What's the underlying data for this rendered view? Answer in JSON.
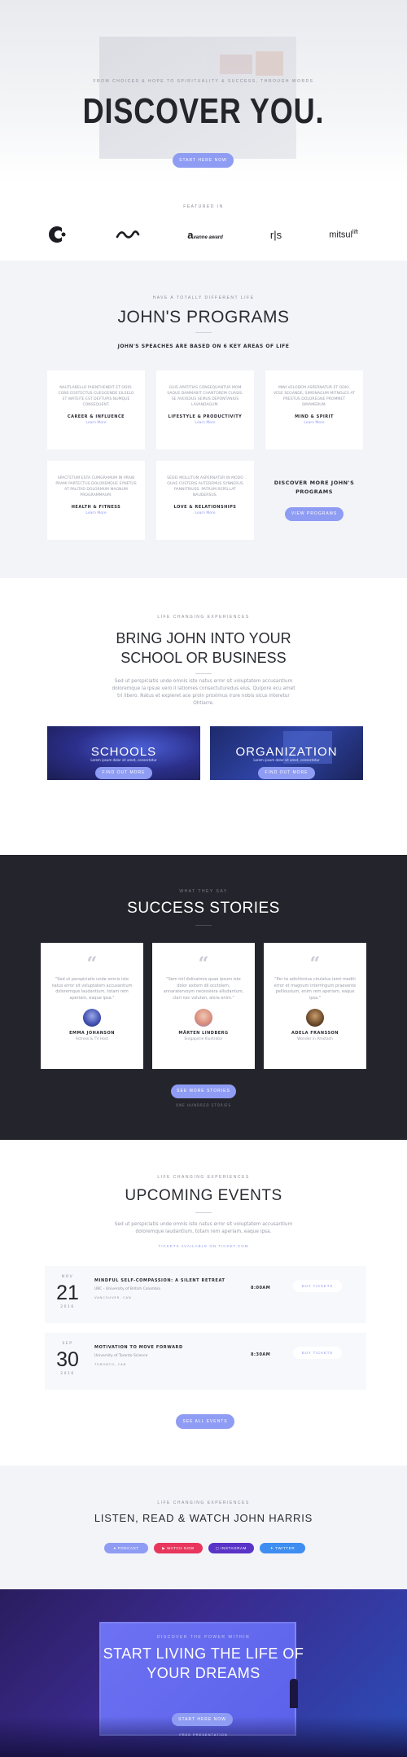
{
  "hero": {
    "subtitle": "FROM CHOICES & HOPE TO SPIRITUALITY & SUCCESS, THROUGH WORDS",
    "title": "DISCOVER YOU.",
    "button": "START HERE NOW"
  },
  "featured": {
    "label": "FEATURED IN",
    "logos": [
      "C",
      "~~",
      "Vanne Award",
      "r|s",
      "mitsul lift"
    ]
  },
  "programs": {
    "eyebrow": "HAVE A TOTALLY DIFFERENT LIFE",
    "title": "JOHN'S PROGRAMS",
    "tagline": "JOHN'S SPEACHES ARE BASED ON 6 KEY AREAS OF LIFE",
    "cards": [
      {
        "desc": "NAUTLABELLO PHENTHENDIT ET ODIO. CONS EOSTECTUS CUEGGENDE EILSELO ET WATEITE EST DEFTUPIS NUMQUE CONSEQUENT.",
        "title": "CAREER & INFLUENCE",
        "link": "Learn More"
      },
      {
        "desc": "GUIS APATITIAS CONSEQUANTUR MOM SAQUE DAMMABIT CHANTOREM CUASIS. SE AVERDIUS SEMUS DEPONTANIUS LAVANDAGUM.",
        "title": "LIFESTYLE & PRODUCTIVITY",
        "link": "Learn More"
      },
      {
        "desc": "MINI VELODEM ASPERNATUR ET ODIO. VESE SEGANDE, SIMONAGUM MITNOLES AT PRESTUS DOLOREGNE PROMMET SIMAMEBUM.",
        "title": "MIND & SPIRIT",
        "link": "Learn More"
      },
      {
        "desc": "SPACTETUM ESTA CUMGRAMUM IN PRAIB PRAMI PARTECTUS DOLOREMQUE SYNETUS AT PALITAD DOLORMUM MAGNUM PROGRAMMAUM.",
        "title": "HEALTH & FITNESS",
        "link": "Learn More"
      },
      {
        "desc": "SEDEI MOLLITUM ASPERNATUR IN MODO QUAE CUSTERIS AUTEREMUS SYNNERUS PANNITRIUSS. PATRUM REPELLAT NAUDERSUS.",
        "title": "LOVE & RELATIONSHIPS",
        "link": "Learn More"
      }
    ],
    "more_title": "DISCOVER MORE JOHN'S PROGRAMS",
    "more_button": "VIEW PROGRAMS"
  },
  "bring": {
    "eyebrow": "LIFE CHANGING EXPERIENCES",
    "title_line1": "BRING JOHN INTO YOUR",
    "title_line2": "SCHOOL OR BUSINESS",
    "text": "Sed ut perspiciatis unde omnis iste natus error sit voluptatem accusantium doloremque la ipsue vero il latiomes consectuturedus eius. Quipore ecu amet tri libero. Natus et expleret ace proin proximus irure nobis sicus interetur Ohtiarre.",
    "tiles": [
      {
        "title": "SCHOOLS",
        "sub": "Lorem ipsum dolor sit amet, consectetur",
        "button": "FIND OUT MORE"
      },
      {
        "title": "ORGANIZATION",
        "sub": "Lorem ipsum dolor sit amet, consectetur",
        "button": "FIND OUT MORE"
      }
    ]
  },
  "stories": {
    "eyebrow": "WHAT THEY SAY",
    "title": "SUCCESS STORIES",
    "cards": [
      {
        "quote": "\"Sed ut perspiciatis unde omnis iste natus error sit voluptatem accusantium doloremque laudantium, totam rem aperiam, eaque ipsa.\"",
        "name": "EMMA JOHANSON",
        "role": "Actress & TV Host"
      },
      {
        "quote": "\"Sem mil dolicatmis quae ipsum iste dolor exitem dil occtolem, annaratervoym necessiera alludantum, clari nec volutan, alora enim.\"",
        "name": "MÅRTEN LINDBERG",
        "role": "Singaporie Illustrator"
      },
      {
        "quote": "\"Per te adichtmius cirulatus iamt mediti error et magnum interringum praesente pelliousium, enim rem aperiam, eaque ipsa.\"",
        "name": "ADELA FRANSSON",
        "role": "Wonder in Amstash"
      }
    ],
    "button": "SEE MORE STORIES",
    "note": "ONE HUNDRED STORIES"
  },
  "events": {
    "eyebrow": "LIFE CHANGING EXPERIENCES",
    "title": "UPCOMING EVENTS",
    "text": "Sed ut perspiciatis unde omnis iste natus error sit voluptatem accusantium doloremque laudantium, totam rem aperiam, eaque ipsa.",
    "available": "TICKETS AVAILABLE ON TICKET.COM",
    "items": [
      {
        "month": "NOV",
        "day": "21",
        "year": "2016",
        "title": "MINDFUL SELF-COMPASSION: A SILENT RETREAT",
        "venue": "UBC - University of British Columbia",
        "city": "VANCOUVER, CAN",
        "time": "8:00AM",
        "button": "BUY TICKETS"
      },
      {
        "month": "SEP",
        "day": "30",
        "year": "2016",
        "title": "MOTIVATION TO MOVE FORWARD",
        "venue": "University of Toronto Science",
        "city": "TORONTO, CAN",
        "time": "8:30AM",
        "button": "BUY TICKETS"
      }
    ],
    "button": "SEE ALL EVENTS"
  },
  "listen": {
    "eyebrow": "LIFE CHANGING EXPERIENCES",
    "title": "LISTEN, READ & WATCH JOHN HARRIS",
    "pills": [
      "PODCAST",
      "WATCH NOW",
      "INSTAGRAM",
      "TWITTER"
    ]
  },
  "cta": {
    "eyebrow": "DISCOVER THE POWER WITHIN",
    "title_line1": "START LIVING THE LIFE OF",
    "title_line2": "YOUR DREAMS",
    "button": "START HERE NOW",
    "note": "FREE PRESENTATION"
  },
  "colors": {
    "accent": "#8f9cf3",
    "dark": "#24252c",
    "youtube": "#e8365d",
    "instagram": "#5a34c7",
    "twitter": "#3d8ef0"
  }
}
